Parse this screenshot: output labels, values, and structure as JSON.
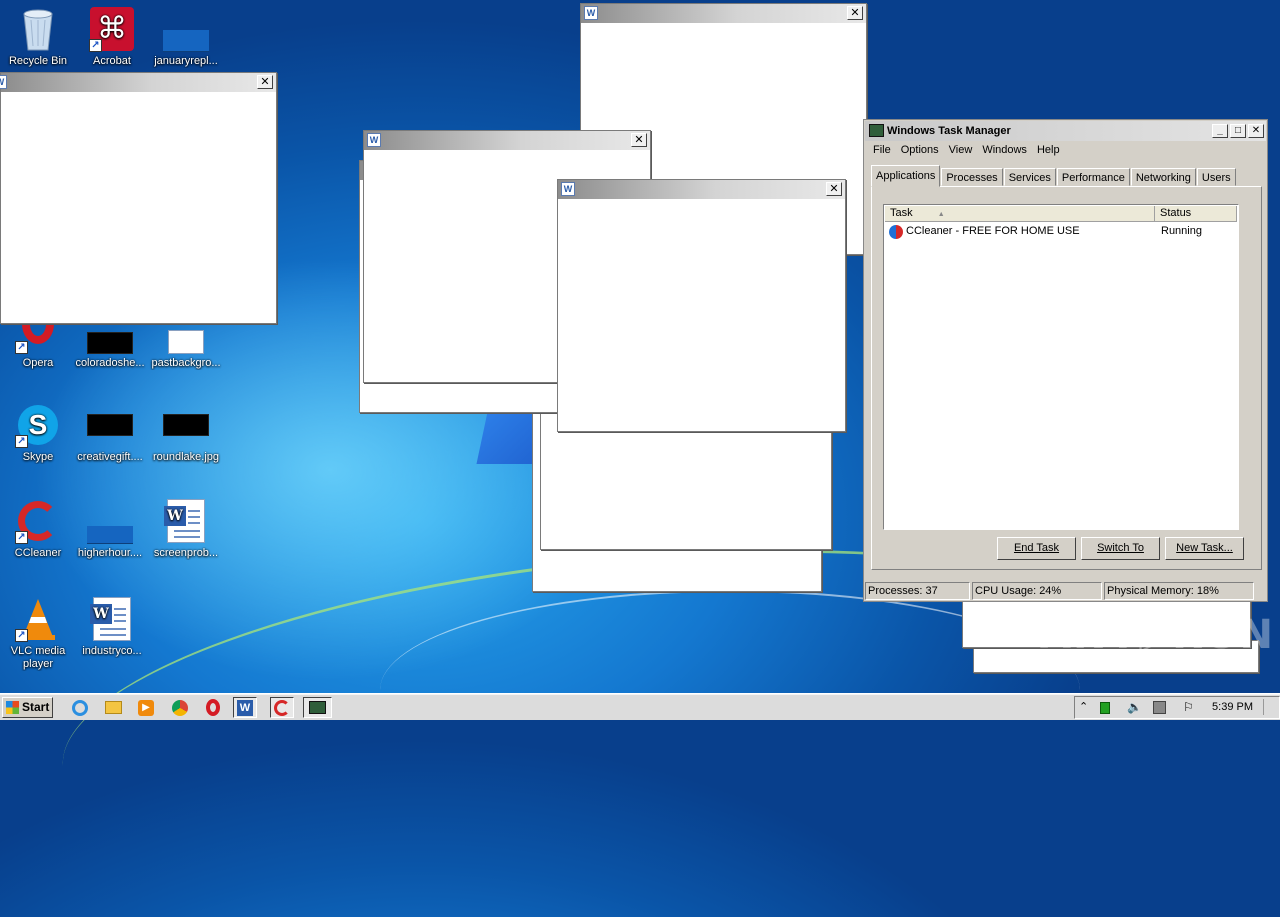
{
  "desktop_icons": [
    {
      "label": "Recycle Bin",
      "icon": "recycle-bin-icon"
    },
    {
      "label": "Acrobat",
      "icon": "acrobat-icon"
    },
    {
      "label": "januaryrepl...",
      "icon": "image-thumbnail-icon"
    },
    {
      "label": "Opera",
      "icon": "opera-icon"
    },
    {
      "label": "coloradoshe...",
      "icon": "image-thumbnail-icon"
    },
    {
      "label": "pastbackgro...",
      "icon": "document-icon"
    },
    {
      "label": "Skype",
      "icon": "skype-icon"
    },
    {
      "label": "creativegift....",
      "icon": "image-thumbnail-icon"
    },
    {
      "label": "roundlake.jpg",
      "icon": "image-thumbnail-icon"
    },
    {
      "label": "CCleaner",
      "icon": "ccleaner-icon"
    },
    {
      "label": "higherhour....",
      "icon": "image-thumbnail-icon"
    },
    {
      "label": "screenprob...",
      "icon": "word-document-icon"
    },
    {
      "label": "VLC media player",
      "icon": "vlc-icon"
    },
    {
      "label": "industryco...",
      "icon": "word-document-icon"
    }
  ],
  "blank_window": {
    "close_glyph": "✕",
    "app_glyph": "W"
  },
  "task_manager": {
    "title": "Windows Task Manager",
    "controls": {
      "minimize": "_",
      "maximize": "□",
      "close": "✕"
    },
    "menu": [
      "File",
      "Options",
      "View",
      "Windows",
      "Help"
    ],
    "tabs": [
      "Applications",
      "Processes",
      "Services",
      "Performance",
      "Networking",
      "Users"
    ],
    "active_tab": "Applications",
    "columns": {
      "task": "Task",
      "status": "Status",
      "sort_glyph": "▲"
    },
    "rows": [
      {
        "task": "CCleaner - FREE FOR HOME USE",
        "status": "Running"
      }
    ],
    "buttons": {
      "end_task": "End Task",
      "switch_to": "Switch To",
      "new_task": "New Task..."
    },
    "status_bar": {
      "processes": "Processes: 37",
      "cpu": "CPU Usage: 24%",
      "memory": "Physical Memory: 18%"
    }
  },
  "taskbar": {
    "start_label": "Start",
    "pinned": [
      "internet-explorer-icon",
      "file-explorer-icon",
      "media-player-icon",
      "chrome-icon",
      "opera-icon",
      "word-icon",
      "ccleaner-icon",
      "task-manager-icon"
    ],
    "clock": "5:39 PM"
  },
  "watermark": "ANY▷RUN"
}
